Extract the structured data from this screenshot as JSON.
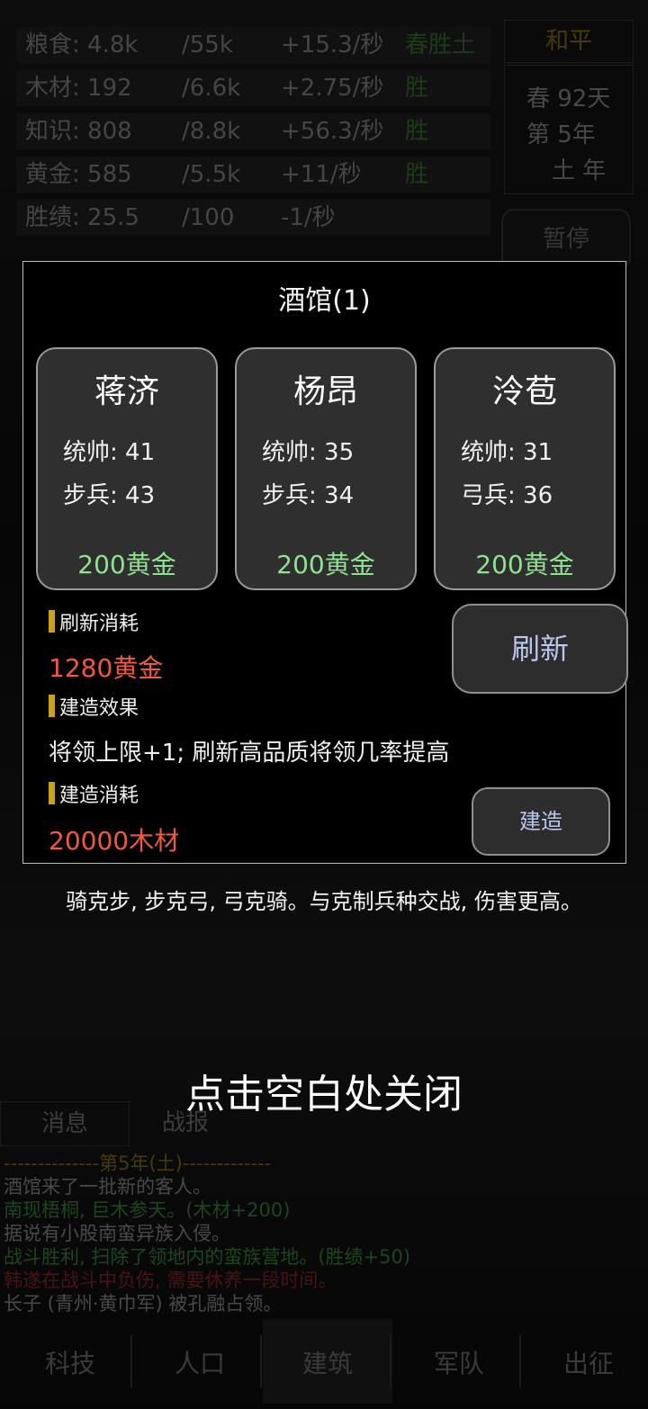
{
  "resources": [
    {
      "name": "粮食: 4.8k",
      "cap": "/55k",
      "rate": "+15.3/秒",
      "tag": "春胜土"
    },
    {
      "name": "木材: 192",
      "cap": "/6.6k",
      "rate": "+2.75/秒",
      "tag": "胜"
    },
    {
      "name": "知识: 808",
      "cap": "/8.8k",
      "rate": "+56.3/秒",
      "tag": "胜"
    },
    {
      "name": "黄金: 585",
      "cap": "/5.5k",
      "rate": "+11/秒",
      "tag": "胜"
    },
    {
      "name": "胜绩: 25.5",
      "cap": "/100",
      "rate": "-1/秒",
      "tag": ""
    }
  ],
  "status": {
    "peace": "和平",
    "season": "春 92天",
    "year": "第 5年",
    "element": "土 年",
    "pause": "暂停"
  },
  "dialog": {
    "title": "酒馆(1)",
    "heroes": [
      {
        "name": "蒋济",
        "stat1": "统帅: 41",
        "stat2": "步兵: 43",
        "price": "200黄金"
      },
      {
        "name": "杨昂",
        "stat1": "统帅: 35",
        "stat2": "步兵: 34",
        "price": "200黄金"
      },
      {
        "name": "泠苞",
        "stat1": "统帅: 31",
        "stat2": "弓兵: 36",
        "price": "200黄金"
      }
    ],
    "refresh_cost_label": "刷新消耗",
    "refresh_cost": "1280黄金",
    "effect_label": "建造效果",
    "effect": "将领上限+1; 刷新高品质将领几率提高",
    "build_cost_label": "建造消耗",
    "build_cost": "20000木材",
    "refresh_button": "刷新",
    "build_button": "建造"
  },
  "hint": "骑克步, 步克弓, 弓克骑。与克制兵种交战, 伤害更高。",
  "close_hint": "点击空白处关闭",
  "log_tabs": [
    "消息",
    "战报"
  ],
  "log": [
    {
      "text": "--------------第5年(土)-------------",
      "color": "#6b5a14"
    },
    {
      "text": "酒馆来了一批新的客人。",
      "color": "#707070"
    },
    {
      "text": "南现梧桐, 巨木参天。(木材+200)",
      "color": "#2f6a2f"
    },
    {
      "text": "据说有小股南蛮异族入侵。",
      "color": "#707070"
    },
    {
      "text": "战斗胜利, 扫除了领地内的蛮族营地。(胜绩+50)",
      "color": "#2f6a2f"
    },
    {
      "text": "韩遂在战斗中负伤, 需要休养一段时间。",
      "color": "#6e1f1f"
    },
    {
      "text": "长子 (青州·黄巾军) 被孔融占领。",
      "color": "#707070"
    }
  ],
  "nav": [
    "科技",
    "人口",
    "建筑",
    "军队",
    "出征"
  ]
}
